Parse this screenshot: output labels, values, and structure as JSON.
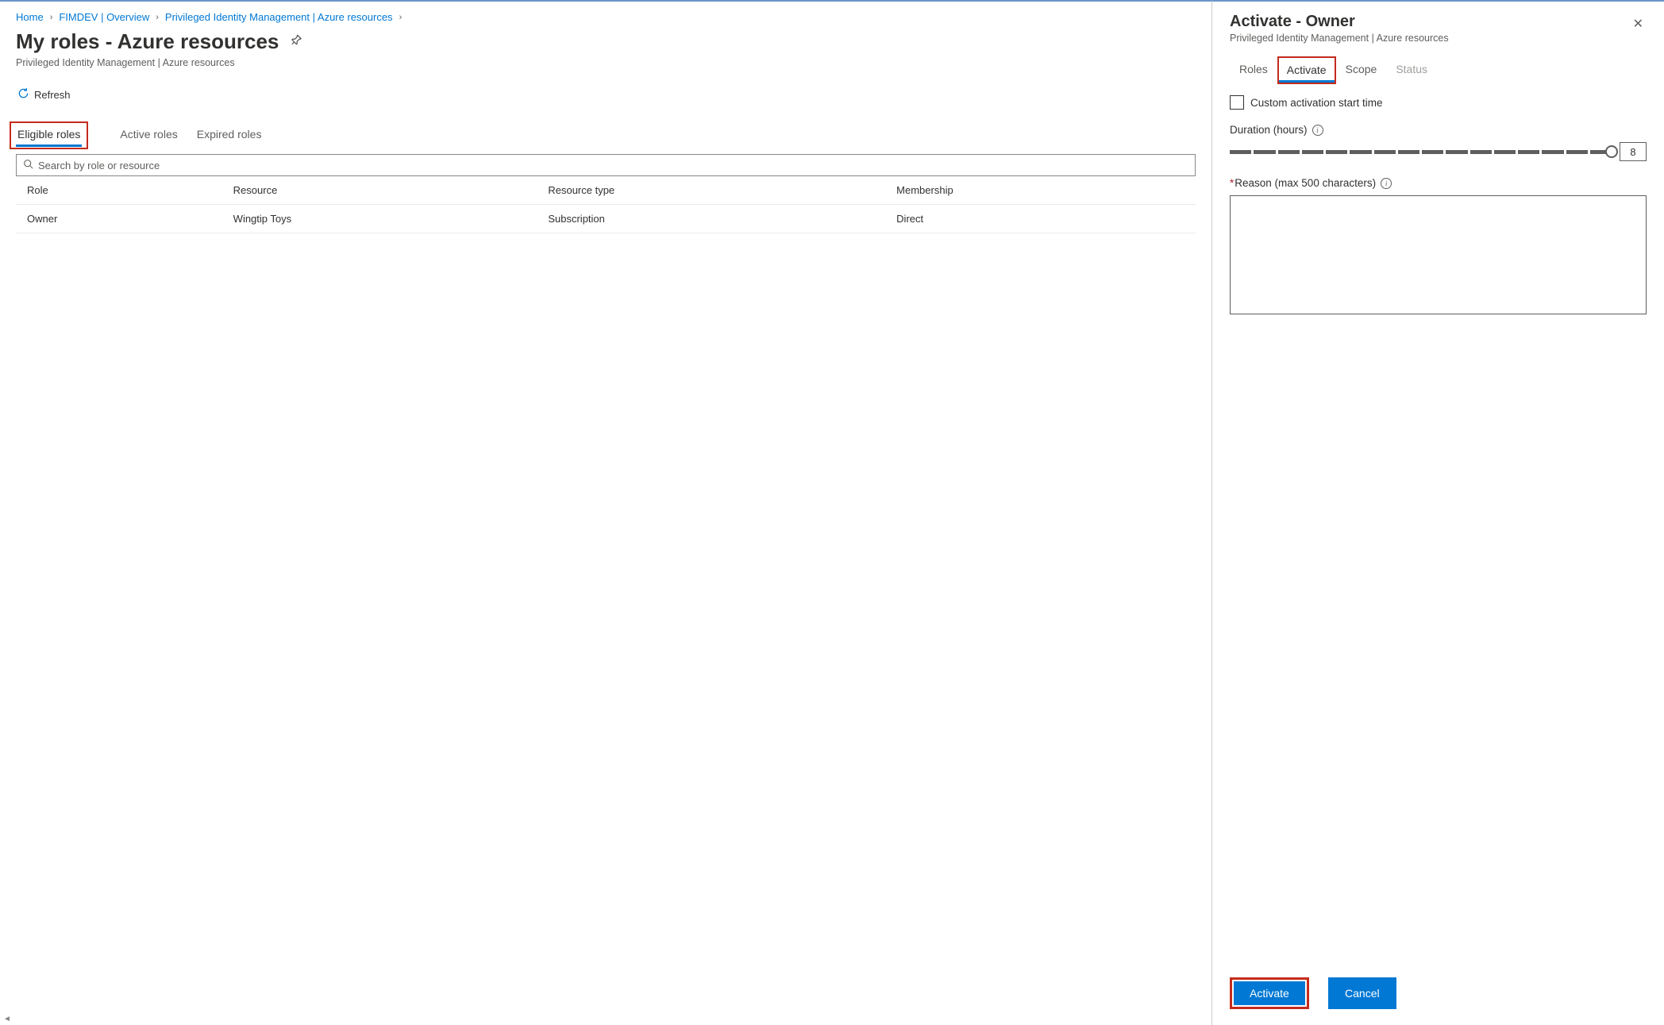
{
  "breadcrumb": {
    "items": [
      {
        "label": "Home"
      },
      {
        "label": "FIMDEV | Overview"
      },
      {
        "label": "Privileged Identity Management | Azure resources"
      }
    ]
  },
  "page": {
    "title": "My roles - Azure resources",
    "subtitle": "Privileged Identity Management | Azure resources"
  },
  "toolbar": {
    "refresh_label": "Refresh"
  },
  "main_tabs": {
    "eligible": "Eligible roles",
    "active": "Active roles",
    "expired": "Expired roles"
  },
  "search": {
    "placeholder": "Search by role or resource"
  },
  "table": {
    "headers": {
      "role": "Role",
      "resource": "Resource",
      "resource_type": "Resource type",
      "membership": "Membership"
    },
    "rows": [
      {
        "role": "Owner",
        "resource": "Wingtip Toys",
        "resource_type": "Subscription",
        "membership": "Direct"
      }
    ]
  },
  "panel": {
    "title": "Activate - Owner",
    "subtitle": "Privileged Identity Management | Azure resources",
    "tabs": {
      "roles": "Roles",
      "activate": "Activate",
      "scope": "Scope",
      "status": "Status"
    },
    "custom_start_label": "Custom activation start time",
    "duration_label": "Duration (hours)",
    "duration_value": "8",
    "reason_label": "Reason (max 500 characters)",
    "activate_btn": "Activate",
    "cancel_btn": "Cancel"
  }
}
